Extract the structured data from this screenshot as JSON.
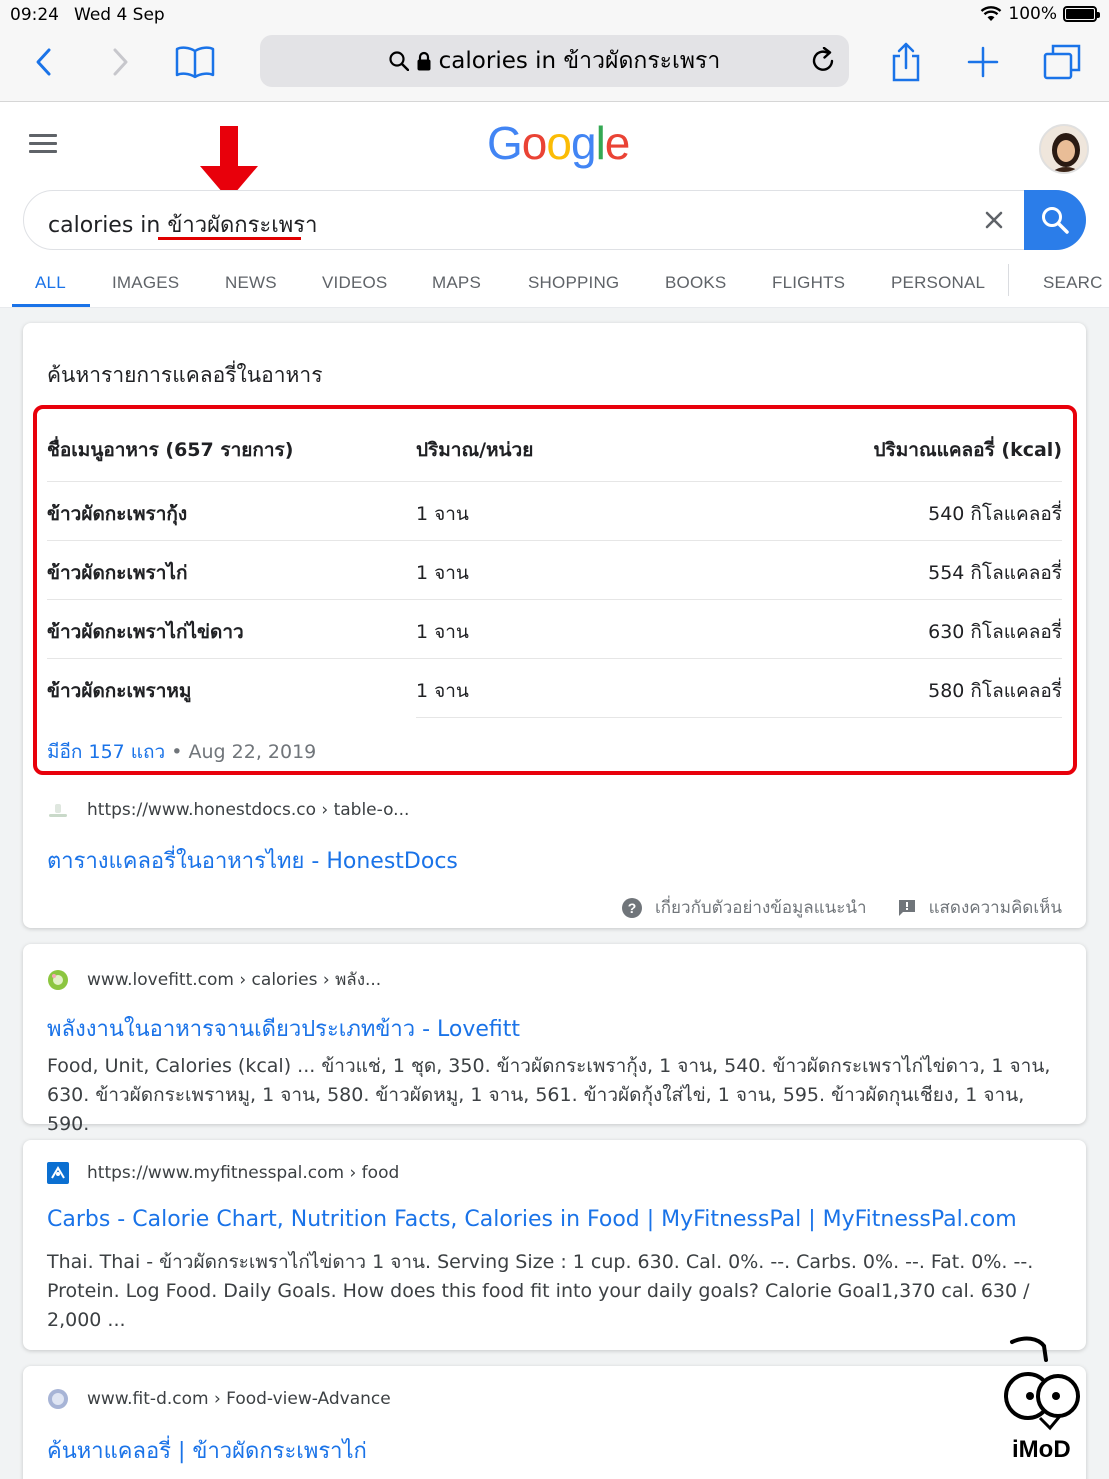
{
  "statusbar": {
    "time": "09:24",
    "date": "Wed 4 Sep",
    "battery": "100%"
  },
  "browser": {
    "url_text": "calories in ข้าวผัดกระเพรา"
  },
  "google": {
    "logo": [
      "G",
      "o",
      "o",
      "g",
      "l",
      "e"
    ],
    "logo_colors": [
      "#4285F4",
      "#EA4335",
      "#FBBC05",
      "#4285F4",
      "#34A853",
      "#EA4335"
    ],
    "query_prefix": "calories in ",
    "query_thai": "ข้าวผัดกระเพรา",
    "tabs": [
      "ALL",
      "IMAGES",
      "NEWS",
      "VIDEOS",
      "MAPS",
      "SHOPPING",
      "BOOKS",
      "FLIGHTS",
      "PERSONAL",
      "SEARC"
    ]
  },
  "featured": {
    "title": "ค้นหารายการแคลอรี่ในอาหาร",
    "headers": [
      "ชื่อเมนูอาหาร (657 รายการ)",
      "ปริมาณ/หน่วย",
      "ปริมาณแคลอรี่ (kcal)"
    ],
    "rows": [
      [
        "ข้าวผัดกะเพรากุ้ง",
        "1 จาน",
        "540 กิโลแคลอรี่"
      ],
      [
        "ข้าวผัดกะเพราไก่",
        "1 จาน",
        "554 กิโลแคลอรี่"
      ],
      [
        "ข้าวผัดกะเพราไก่ไข่ดาว",
        "1 จาน",
        "630 กิโลแคลอรี่"
      ],
      [
        "ข้าวผัดกะเพราหมู",
        "1 จาน",
        "580 กิโลแคลอรี่"
      ]
    ],
    "more_link": "มีอีก 157 แถว",
    "separator": "•",
    "date": "Aug 22, 2019",
    "source_url": "https://www.honestdocs.co › table-o...",
    "source_title": "ตารางแคลอรี่ในอาหารไทย - HonestDocs",
    "about_label": "เกี่ยวกับตัวอย่างข้อมูลแนะนำ",
    "feedback_label": "แสดงความคิดเห็น"
  },
  "results": [
    {
      "url": "www.lovefitt.com › calories › พลัง...",
      "title": "พลังงานในอาหารจานเดียวประเภทข้าว - Lovefitt",
      "snippet": "Food, Unit, Calories (kcal) ... ข้าวแช่, 1 ชุด, 350. ข้าวผัดกระเพรากุ้ง, 1 จาน, 540. ข้าวผัดกระเพราไก่ไข่ดาว, 1 จาน, 630. ข้าวผัดกระเพราหมู, 1 จาน, 580. ข้าวผัดหมู, 1 จาน, 561. ข้าวผัดกุ้งใส่ไข่, 1 จาน, 595. ข้าวผัดกุนเชียง, 1 จาน, 590."
    },
    {
      "url": "https://www.myfitnesspal.com › food",
      "title": "Carbs - Calorie Chart, Nutrition Facts, Calories in Food | MyFitnessPal | MyFitnessPal.com",
      "snippet": "Thai. Thai - ข้าวผัดกระเพราไก่ไข่ดาว 1 จาน. Serving Size : 1 cup. 630. Cal. 0%. --. Carbs. 0%. --. Fat. 0%. --. Protein. Log Food. Daily Goals. How does this food fit into your daily goals? Calorie Goal1,370 cal. 630 / 2,000 ..."
    },
    {
      "url": "www.fit-d.com › Food-view-Advance",
      "title": "ค้นหาแคลอรี่ | ข้าวผัดกระเพราไก่"
    }
  ],
  "watermark": "iMoD",
  "colors": {
    "link": "#1a73e8",
    "accent_red": "#e8000b",
    "search_button": "#2b7de9"
  }
}
